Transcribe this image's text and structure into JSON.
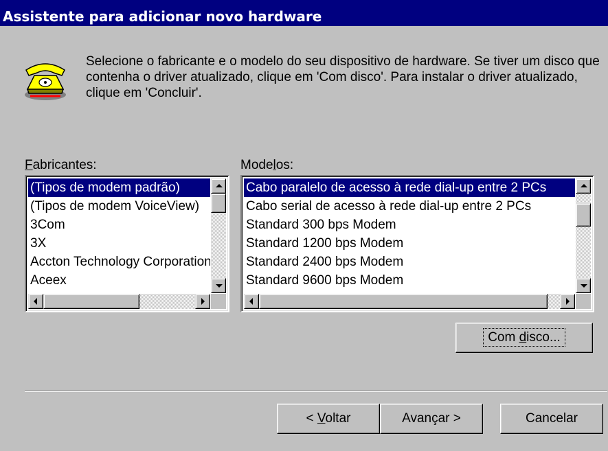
{
  "window": {
    "title": "Assistente para adicionar novo hardware"
  },
  "intro_text": "Selecione o fabricante e o modelo do seu dispositivo de hardware. Se tiver um disco que contenha o driver atualizado, clique em 'Com disco'. Para instalar o driver atualizado, clique em 'Concluir'.",
  "manufacturers": {
    "label_mnemonic": "F",
    "label_rest": "abricantes:",
    "items": [
      "(Tipos de modem padrão)",
      "(Tipos de modem VoiceView)",
      "3Com",
      "3X",
      "Accton Technology Corporation",
      "Aceex"
    ],
    "selected_index": 0
  },
  "models": {
    "label_before": "Mode",
    "label_mnemonic": "l",
    "label_after": "os:",
    "items": [
      "Cabo paralelo de acesso à rede dial-up entre 2 PCs",
      "Cabo serial de acesso à rede dial-up entre 2 PCs",
      "Standard   300 bps Modem",
      "Standard  1200 bps Modem",
      "Standard  2400 bps Modem",
      "Standard  9600 bps Modem"
    ],
    "selected_index": 0
  },
  "buttons": {
    "have_disk_before": "Com ",
    "have_disk_mnemonic": "d",
    "have_disk_after": "isco...",
    "back_before": "< ",
    "back_mnemonic": "V",
    "back_after": "oltar",
    "next": "Avançar >",
    "cancel": "Cancelar"
  },
  "icon": "telephone-icon"
}
